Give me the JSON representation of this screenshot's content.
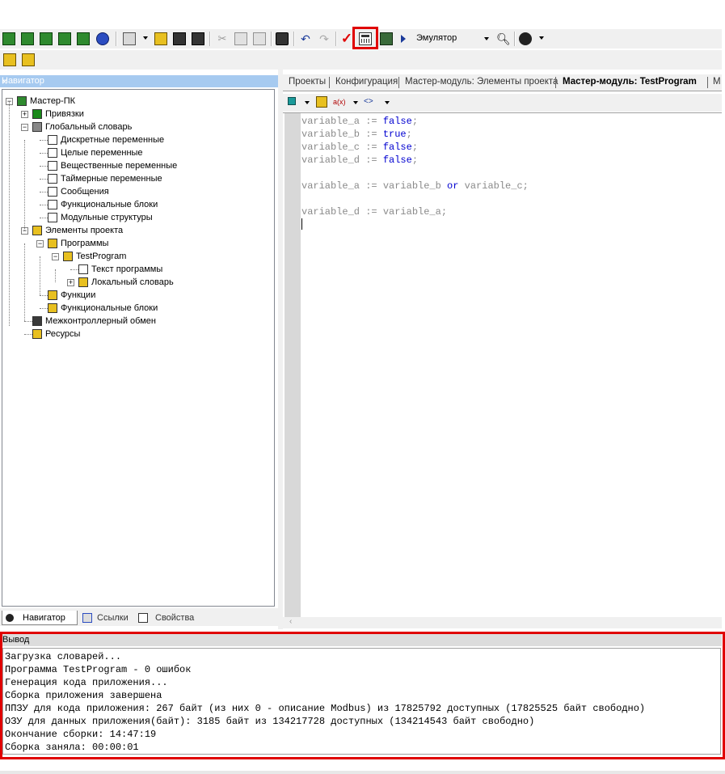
{
  "toolbar": {
    "target_combo": "Эмулятор"
  },
  "navigator": {
    "title": "Навигатор",
    "close": "×",
    "tree": [
      {
        "label": "Мастер-ПК",
        "level": 0,
        "expander": "minus",
        "icon": "plc-icon"
      },
      {
        "label": "Привязки",
        "level": 1,
        "expander": "plus",
        "icon": "bindings-icon"
      },
      {
        "label": "Глобальный словарь",
        "level": 1,
        "expander": "minus",
        "icon": "dictionary-icon"
      },
      {
        "label": "Дискретные переменные",
        "level": 2,
        "expander": "",
        "icon": "discrete-var-icon"
      },
      {
        "label": "Целые переменные",
        "level": 2,
        "expander": "",
        "icon": "integer-var-icon"
      },
      {
        "label": "Вещественные переменные",
        "level": 2,
        "expander": "",
        "icon": "real-var-icon"
      },
      {
        "label": "Таймерные переменные",
        "level": 2,
        "expander": "",
        "icon": "timer-var-icon"
      },
      {
        "label": "Сообщения",
        "level": 2,
        "expander": "",
        "icon": "message-icon"
      },
      {
        "label": "Функциональные блоки",
        "level": 2,
        "expander": "",
        "icon": "function-block-icon"
      },
      {
        "label": "Модульные структуры",
        "level": 2,
        "expander": "",
        "icon": "module-struct-icon"
      },
      {
        "label": "Элементы проекта",
        "level": 1,
        "expander": "minus",
        "icon": "project-folder-icon"
      },
      {
        "label": "Программы",
        "level": 2,
        "expander": "minus",
        "icon": "programs-icon"
      },
      {
        "label": "TestProgram",
        "level": 3,
        "expander": "minus",
        "icon": "program-icon"
      },
      {
        "label": "Текст программы",
        "level": 4,
        "expander": "",
        "icon": "program-text-icon"
      },
      {
        "label": "Локальный словарь",
        "level": 4,
        "expander": "plus",
        "icon": "local-dictionary-icon"
      },
      {
        "label": "Функции",
        "level": 2,
        "expander": "",
        "icon": "functions-icon"
      },
      {
        "label": "Функциональные блоки",
        "level": 2,
        "expander": "",
        "icon": "function-blocks-folder-icon"
      },
      {
        "label": "Межконтроллерный обмен",
        "level": 1,
        "expander": "",
        "icon": "exchange-icon"
      },
      {
        "label": "Ресурсы",
        "level": 1,
        "expander": "",
        "icon": "resources-icon"
      }
    ],
    "tabs": [
      "Навигатор",
      "Ссылки",
      "Свойства"
    ]
  },
  "documents": {
    "tabs": [
      "Проекты",
      "Конфигурация",
      "Мастер-модуль: Элементы проекта",
      "Мастер-модуль: TestProgram",
      "М"
    ]
  },
  "editor": {
    "lines": [
      [
        [
          "variable_a := ",
          ""
        ],
        [
          "false",
          "kw"
        ],
        [
          ";",
          ""
        ]
      ],
      [
        [
          "variable_b := ",
          ""
        ],
        [
          "true",
          "kw"
        ],
        [
          ";",
          ""
        ]
      ],
      [
        [
          "variable_c := ",
          ""
        ],
        [
          "false",
          "kw"
        ],
        [
          ";",
          ""
        ]
      ],
      [
        [
          "variable_d := ",
          ""
        ],
        [
          "false",
          "kw"
        ],
        [
          ";",
          ""
        ]
      ],
      [],
      [
        [
          "variable_a := variable_b ",
          ""
        ],
        [
          "or",
          "kw"
        ],
        [
          " variable_c;",
          ""
        ]
      ],
      [],
      [
        [
          "variable_d := variable_a;",
          ""
        ]
      ]
    ]
  },
  "output": {
    "title": "Вывод",
    "lines": [
      "Загрузка словарей...",
      "Программа TestProgram - 0 ошибок",
      "Генерация кода приложения...",
      "Сборка приложения завершена",
      "ППЗУ для кода приложения: 267 байт (из них 0 - описание Modbus) из 17825792 доступных (17825525 байт свободно)",
      "ОЗУ для данных приложения(байт): 3185 байт из 134217728 доступных (134214543 байт свободно)",
      "Окончание сборки: 14:47:19",
      "Сборка заняла: 00:00:01"
    ]
  }
}
